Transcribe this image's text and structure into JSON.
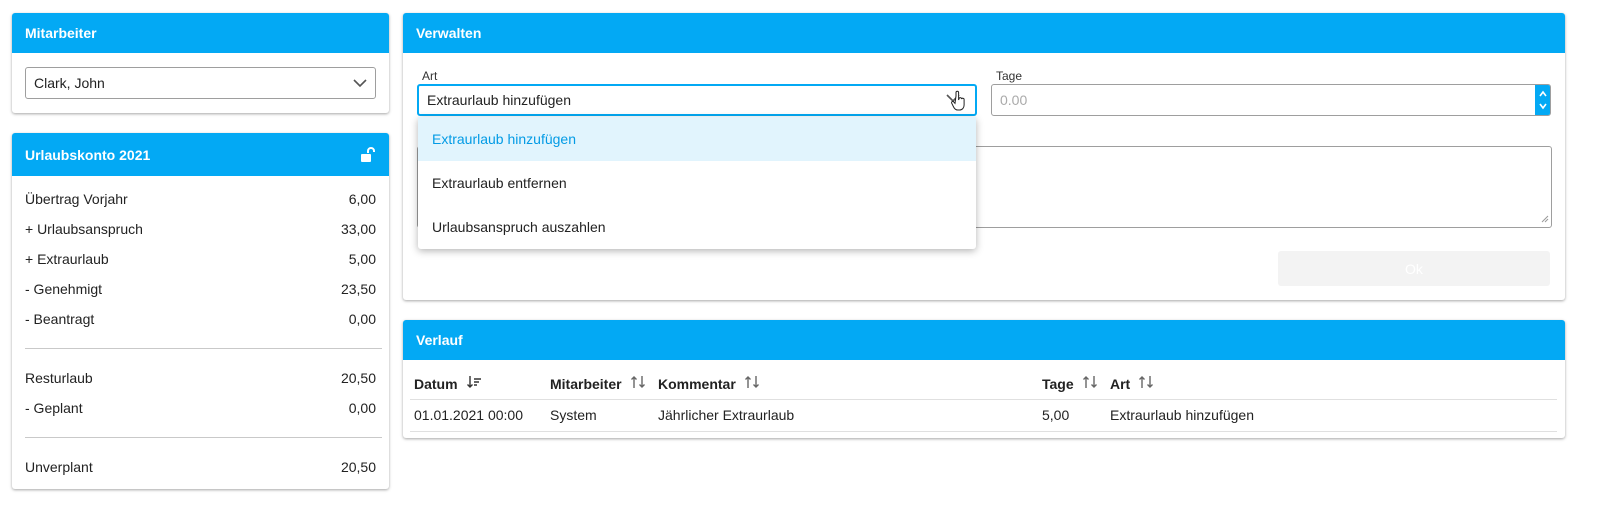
{
  "employee_panel": {
    "title": "Mitarbeiter",
    "selected": "Clark, John"
  },
  "account_panel": {
    "title": "Urlaubskonto 2021",
    "rows": [
      {
        "label": "Übertrag Vorjahr",
        "value": "6,00"
      },
      {
        "label": "+ Urlaubsanspruch",
        "value": "33,00"
      },
      {
        "label": "+ Extraurlaub",
        "value": "5,00"
      },
      {
        "label": "- Genehmigt",
        "value": "23,50"
      },
      {
        "label": "- Beantragt",
        "value": "0,00"
      }
    ],
    "rows2": [
      {
        "label": "Resturlaub",
        "value": "20,50"
      },
      {
        "label": "- Geplant",
        "value": "0,00"
      }
    ],
    "total": {
      "label": "Unverplant",
      "value": "20,50"
    }
  },
  "manage_panel": {
    "title": "Verwalten",
    "art_label": "Art",
    "art_value": "Extraurlaub hinzufügen",
    "tage_label": "Tage",
    "tage_placeholder": "0.00",
    "ok_label": "Ok",
    "options": [
      "Extraurlaub hinzufügen",
      "Extraurlaub entfernen",
      "Urlaubsanspruch auszahlen"
    ]
  },
  "history_panel": {
    "title": "Verlauf",
    "columns": [
      "Datum",
      "Mitarbeiter",
      "Kommentar",
      "Tage",
      "Art"
    ],
    "rows": [
      [
        "01.01.2021 00:00",
        "System",
        "Jährlicher Extraurlaub",
        "5,00",
        "Extraurlaub hinzufügen"
      ]
    ]
  },
  "colors": {
    "accent": "#03a9f4",
    "active_option_bg": "#e1f4fd"
  }
}
